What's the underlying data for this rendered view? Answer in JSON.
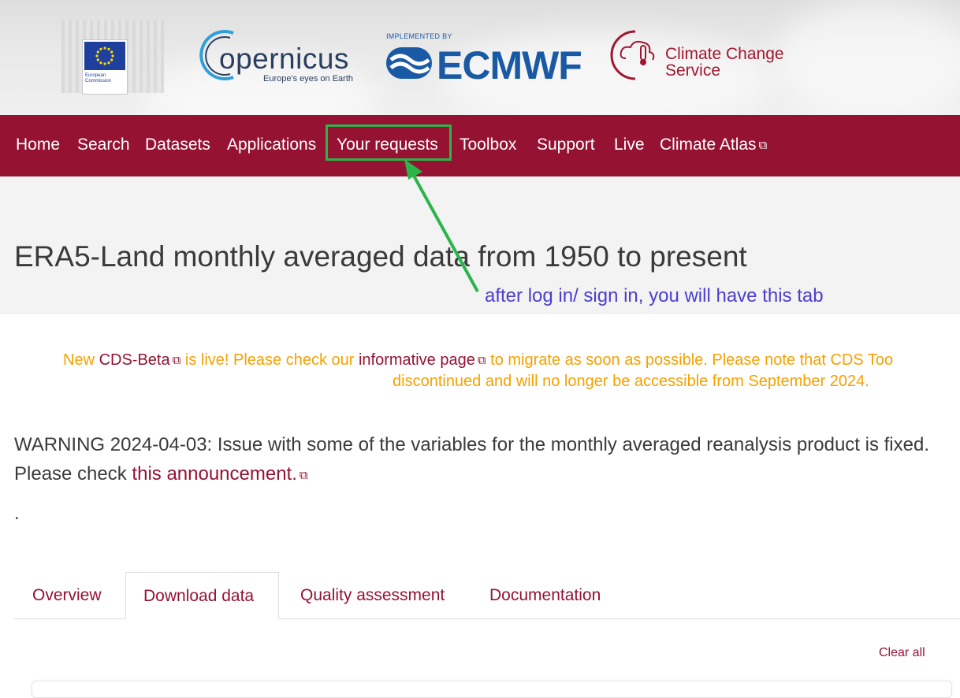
{
  "header": {
    "ec_logo_text": "European Commission",
    "copernicus_word": "opernicus",
    "copernicus_tagline": "Europe's eyes on Earth",
    "ecmwf_implemented_by": "IMPLEMENTED BY",
    "ecmwf_word": "ECMWF",
    "c3s_line1": "Climate Change",
    "c3s_line2": "Service"
  },
  "nav": {
    "items": [
      {
        "label": "Home"
      },
      {
        "label": "Search"
      },
      {
        "label": "Datasets"
      },
      {
        "label": "Applications"
      },
      {
        "label": "Your requests"
      },
      {
        "label": "Toolbox"
      },
      {
        "label": "Support"
      },
      {
        "label": "Live"
      },
      {
        "label": "Climate Atlas"
      }
    ],
    "external_icon": "external-link-icon"
  },
  "page": {
    "title": "ERA5-Land monthly averaged data from 1950 to present"
  },
  "annotation": {
    "text": "after log in/ sign in, you will have this tab",
    "highlight_color": "#2bb44a",
    "text_color": "#4b3fce"
  },
  "notice": {
    "part1": "New ",
    "link1": "CDS-Beta",
    "part2": " is live! Please check our ",
    "link2": "informative page",
    "part3": " to migrate as soon as possible. Please note that CDS Too",
    "line2": "discontinued and will no longer be accessible from September 2024."
  },
  "warning": {
    "label": "WARNING 2024-04-03",
    "text": ": Issue with some of the variables for the monthly averaged reanalysis product is fixed. Please check ",
    "link": "this announcement.",
    "trailing": "."
  },
  "tabs": [
    {
      "label": "Overview"
    },
    {
      "label": "Download data"
    },
    {
      "label": "Quality assessment"
    },
    {
      "label": "Documentation"
    }
  ],
  "actions": {
    "clear_all": "Clear all"
  },
  "colors": {
    "brand": "#951232",
    "notice": "#f5a100",
    "ecmwf_blue": "#1a5aa5"
  }
}
